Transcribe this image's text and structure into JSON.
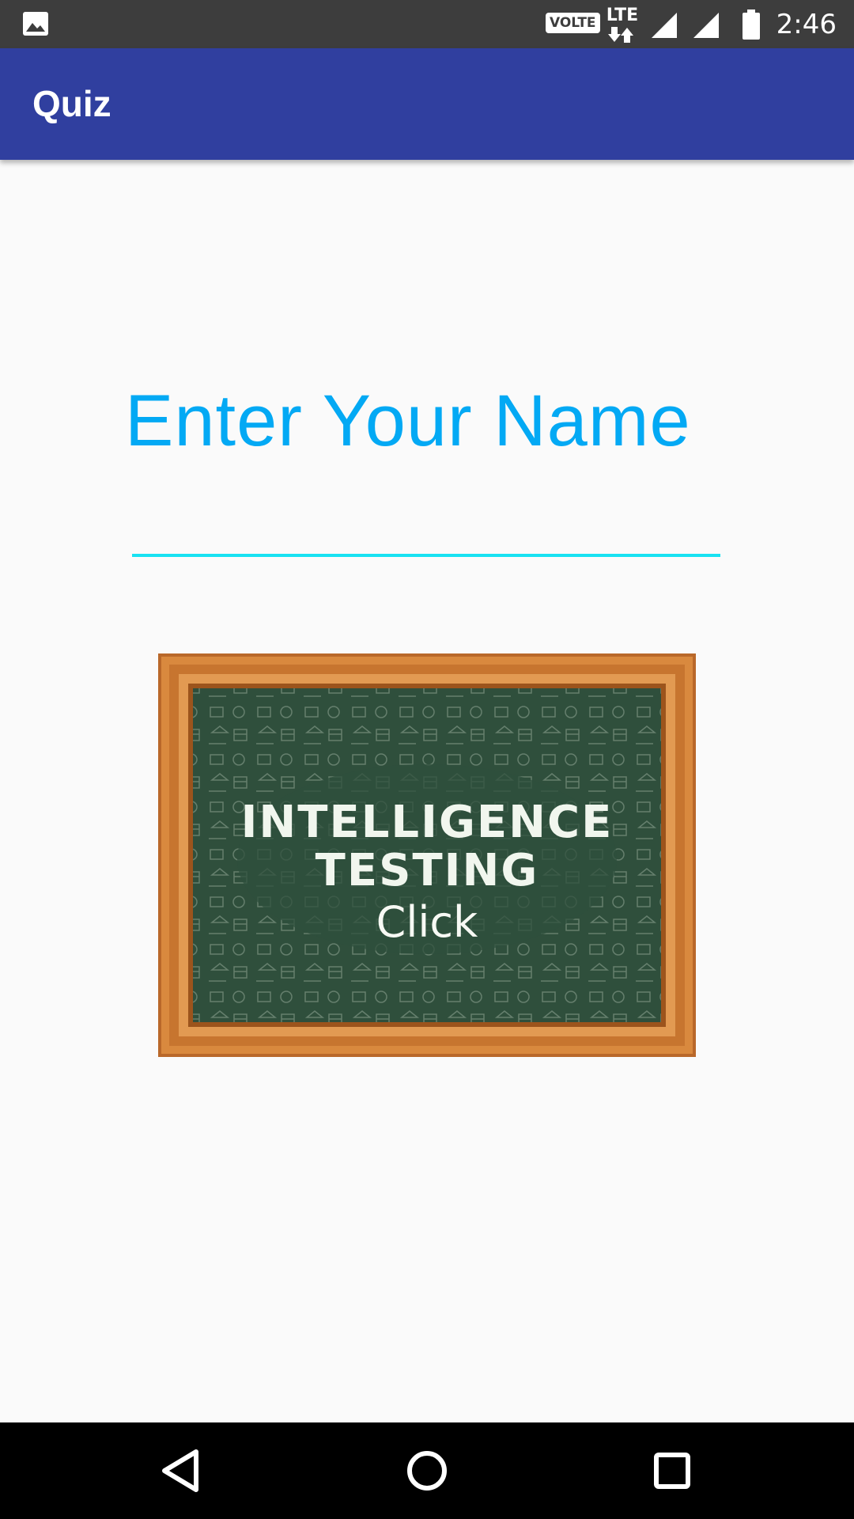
{
  "status_bar": {
    "notification_icon": "image-gallery-icon",
    "volte_label": "VOLTE",
    "network_label": "LTE",
    "time": "2:46",
    "icons": [
      "image-gallery-icon",
      "volte-badge",
      "lte-data-icon",
      "cell-signal-icon",
      "cell-signal-icon",
      "battery-icon"
    ]
  },
  "app_bar": {
    "title": "Quiz",
    "color": "#303f9f"
  },
  "main": {
    "prompt_label": "Enter Your Name",
    "prompt_color": "#03a9f4",
    "name_input": {
      "value": "",
      "placeholder": "",
      "underline_color": "#18e2f2"
    },
    "start_image": {
      "title_line_1": "INTELLIGENCE",
      "title_line_2": "TESTING",
      "action_label": "Click",
      "board_color": "#2f4f3c",
      "frame_color": "#c8772d"
    }
  },
  "nav_bar": {
    "buttons": [
      "back-icon",
      "home-icon",
      "recents-icon"
    ]
  }
}
